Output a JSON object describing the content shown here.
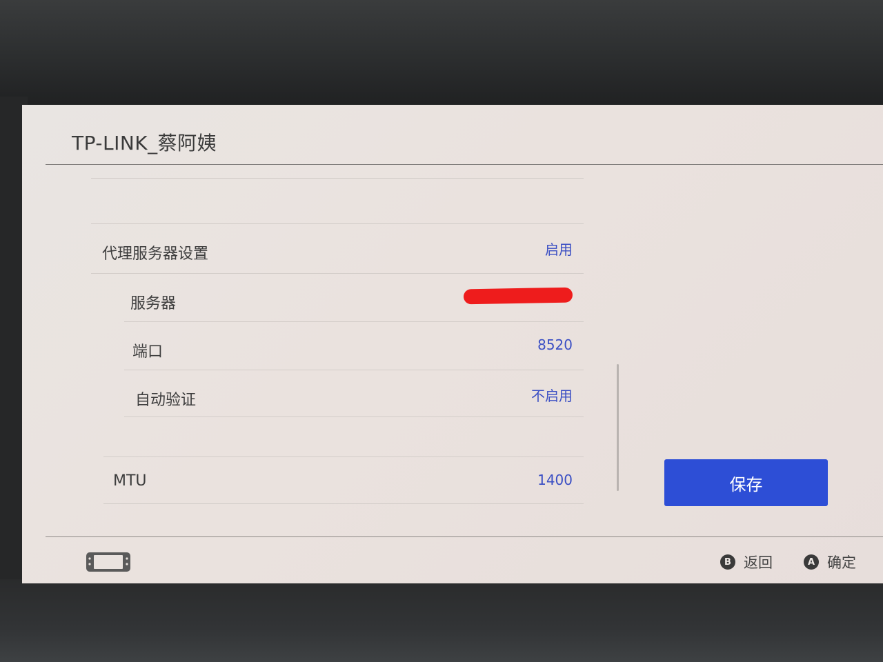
{
  "header": {
    "title": "TP-LINK_蔡阿姨"
  },
  "settings": {
    "proxy": {
      "label": "代理服务器设置",
      "value": "启用"
    },
    "server": {
      "label": "服务器"
    },
    "port": {
      "label": "端口",
      "value": "8520"
    },
    "auth": {
      "label": "自动验证",
      "value": "不启用"
    },
    "mtu": {
      "label": "MTU",
      "value": "1400"
    }
  },
  "actions": {
    "save_label": "保存"
  },
  "footer": {
    "back": {
      "key": "B",
      "label": "返回"
    },
    "confirm": {
      "key": "A",
      "label": "确定"
    }
  },
  "colors": {
    "accent": "#2d4ed6",
    "value_text": "#3b4fc4",
    "redaction": "#ee1c1c"
  }
}
